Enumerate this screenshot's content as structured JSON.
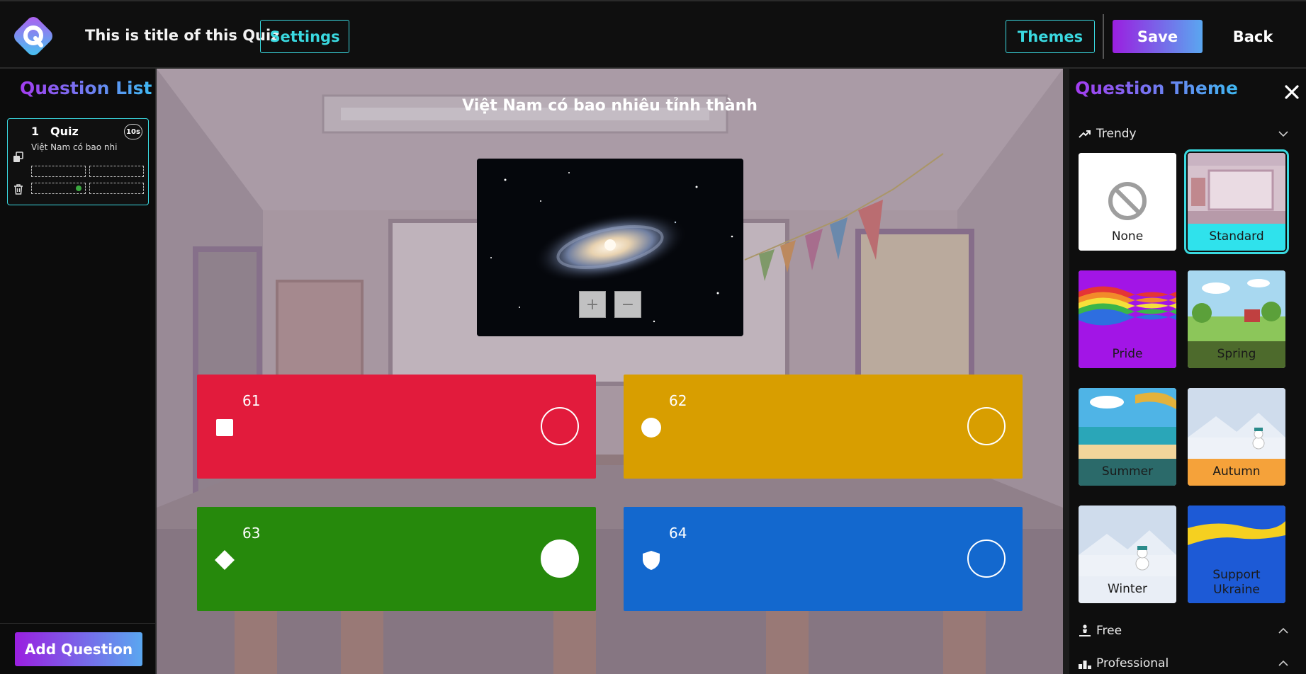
{
  "header": {
    "quiz_title": "This is title of this Quiz",
    "settings_label": "Settings",
    "themes_label": "Themes",
    "save_label": "Save",
    "back_label": "Back",
    "accent_color": "#3ad9e0"
  },
  "question_list": {
    "title": "Question List",
    "items": [
      {
        "number": "1",
        "type": "Quiz",
        "time": "10s",
        "preview": "Việt Nam có bao nhi"
      }
    ],
    "add_label": "Add Question"
  },
  "editor": {
    "question": "Việt Nam có bao nhiêu tỉnh thành",
    "zoom_in": "+",
    "zoom_out": "−",
    "answers": [
      {
        "text": "61",
        "shape": "square",
        "color": "#e21b3c",
        "correct": false
      },
      {
        "text": "62",
        "shape": "circle",
        "color": "#d89e00",
        "correct": false
      },
      {
        "text": "63",
        "shape": "diamond",
        "color": "#26890c",
        "correct": true
      },
      {
        "text": "64",
        "shape": "shield",
        "color": "#1368ce",
        "correct": false
      }
    ]
  },
  "theme_panel": {
    "title": "Question Theme",
    "sections": [
      {
        "label": "Trendy",
        "icon": "trending-up-icon",
        "expanded": true
      },
      {
        "label": "Free",
        "icon": "person-icon",
        "expanded": false
      },
      {
        "label": "Professional",
        "icon": "podium-icon",
        "expanded": false
      }
    ],
    "themes": [
      {
        "label": "None",
        "label_bg": "#ffffff",
        "selected": false
      },
      {
        "label": "Standard",
        "label_bg": "#2fe2ec",
        "selected": true
      },
      {
        "label": "Pride",
        "label_bg": "#a215e6",
        "selected": false
      },
      {
        "label": "Spring",
        "label_bg": "#4d6a2c",
        "selected": false
      },
      {
        "label": "Summer",
        "label_bg": "#2b6a6a",
        "selected": false
      },
      {
        "label": "Autumn",
        "label_bg": "#f5a23a",
        "selected": false
      },
      {
        "label": "Winter",
        "label_bg": "#e9eef6",
        "selected": false
      },
      {
        "label": "Support Ukraine",
        "label_bg": "#1d5ad6",
        "selected": false
      }
    ]
  }
}
